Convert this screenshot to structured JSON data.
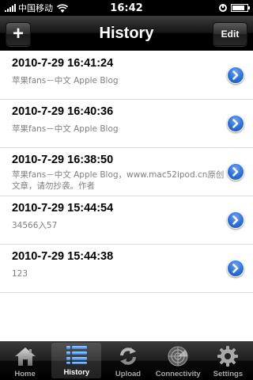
{
  "status": {
    "carrier": "中国移动",
    "time": "16:42",
    "battery_level": 0.85
  },
  "navbar": {
    "title": "History",
    "add_label": "+",
    "edit_label": "Edit"
  },
  "history": [
    {
      "timestamp": "2010-7-29 16:41:24",
      "snippet": "苹果fans－中文 Apple Blog"
    },
    {
      "timestamp": "2010-7-29 16:40:36",
      "snippet": "苹果fans－中文 Apple Blog"
    },
    {
      "timestamp": "2010-7-29 16:38:50",
      "snippet": "苹果fans－中文 Apple Blog，www.mac52ipod.cn原创文章，请勿抄袭。作者"
    },
    {
      "timestamp": "2010-7-29 15:44:54",
      "snippet": "34566入57"
    },
    {
      "timestamp": "2010-7-29 15:44:38",
      "snippet": "123"
    }
  ],
  "tabbar": {
    "selected": "history",
    "tabs": [
      {
        "id": "home",
        "label": "Home",
        "icon": "house-icon"
      },
      {
        "id": "history",
        "label": "History",
        "icon": "list-icon"
      },
      {
        "id": "upload",
        "label": "Upload",
        "icon": "refresh-icon"
      },
      {
        "id": "connectivity",
        "label": "Connectivity",
        "icon": "radar-icon"
      },
      {
        "id": "settings",
        "label": "Settings",
        "icon": "gear-icon"
      }
    ]
  },
  "colors": {
    "accent_blue": "#2b6fdc",
    "navbar_bg": "#000000",
    "subtitle_gray": "#7f7f7f"
  }
}
